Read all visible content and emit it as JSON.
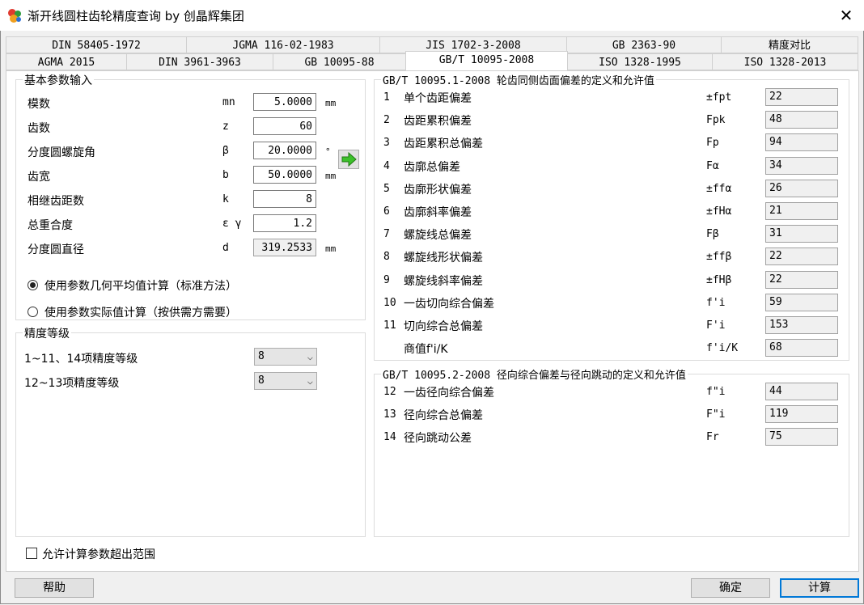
{
  "window": {
    "title": "渐开线圆柱齿轮精度查询 by 创晶辉集团",
    "close_glyph": "✕"
  },
  "tabs": {
    "row1": [
      "DIN 58405-1972",
      "JGMA 116-02-1983",
      "JIS 1702-3-2008",
      "GB 2363-90",
      "精度对比"
    ],
    "row2": [
      "AGMA 2015",
      "DIN 3961-3963",
      "GB 10095-88",
      "GB/T 10095-2008",
      "ISO 1328-1995",
      "ISO 1328-2013"
    ],
    "active": "GB/T 10095-2008"
  },
  "basic": {
    "title": "基本参数输入",
    "rows": [
      {
        "label": "模数",
        "symbol": "mn",
        "value": "5.0000",
        "unit": "mm"
      },
      {
        "label": "齿数",
        "symbol": "z",
        "value": "60",
        "unit": ""
      },
      {
        "label": "分度圆螺旋角",
        "symbol": "β",
        "value": "20.0000",
        "unit": "°"
      },
      {
        "label": "齿宽",
        "symbol": "b",
        "value": "50.0000",
        "unit": "mm"
      },
      {
        "label": "相继齿距数",
        "symbol": "k",
        "value": "8",
        "unit": ""
      },
      {
        "label": "总重合度",
        "symbol": "ε γ",
        "value": "1.2",
        "unit": ""
      },
      {
        "label": "分度圆直径",
        "symbol": "d",
        "value": "319.2533",
        "unit": "mm"
      }
    ],
    "radio1": "使用参数几何平均值计算（标准方法）",
    "radio2": "使用参数实际值计算（按供需方需要）"
  },
  "grade": {
    "title": "精度等级",
    "row1_label": "1~11、14项精度等级",
    "row1_value": "8",
    "row2_label": "12~13项精度等级",
    "row2_value": "8"
  },
  "allow_label": "允许计算参数超出范围",
  "part1": {
    "title": "GB/T 10095.1-2008 轮齿同侧齿面偏差的定义和允许值",
    "rows": [
      {
        "idx": "1",
        "name": "单个齿距偏差",
        "sym": "±fpt",
        "val": "22"
      },
      {
        "idx": "2",
        "name": "齿距累积偏差",
        "sym": "Fpk",
        "val": "48"
      },
      {
        "idx": "3",
        "name": "齿距累积总偏差",
        "sym": "Fp",
        "val": "94"
      },
      {
        "idx": "4",
        "name": "齿廓总偏差",
        "sym": "Fα",
        "val": "34"
      },
      {
        "idx": "5",
        "name": "齿廓形状偏差",
        "sym": "±ffα",
        "val": "26"
      },
      {
        "idx": "6",
        "name": "齿廓斜率偏差",
        "sym": "±fHα",
        "val": "21"
      },
      {
        "idx": "7",
        "name": "螺旋线总偏差",
        "sym": "Fβ",
        "val": "31"
      },
      {
        "idx": "8",
        "name": "螺旋线形状偏差",
        "sym": "±ffβ",
        "val": "22"
      },
      {
        "idx": "9",
        "name": "螺旋线斜率偏差",
        "sym": "±fHβ",
        "val": "22"
      },
      {
        "idx": "10",
        "name": "一齿切向综合偏差",
        "sym": "f'i",
        "val": "59"
      },
      {
        "idx": "11",
        "name": "切向综合总偏差",
        "sym": "F'i",
        "val": "153"
      },
      {
        "idx": "",
        "name": "商值f'i/K",
        "sym": "f'i/K",
        "val": "68"
      }
    ]
  },
  "part2": {
    "title": "GB/T 10095.2-2008 径向综合偏差与径向跳动的定义和允许值",
    "rows": [
      {
        "idx": "12",
        "name": "一齿径向综合偏差",
        "sym": "f\"i",
        "val": "44"
      },
      {
        "idx": "13",
        "name": "径向综合总偏差",
        "sym": "F\"i",
        "val": "119"
      },
      {
        "idx": "14",
        "name": "径向跳动公差",
        "sym": "Fr",
        "val": "75"
      }
    ]
  },
  "buttons": {
    "help": "帮助",
    "ok": "确定",
    "calc": "计算"
  }
}
